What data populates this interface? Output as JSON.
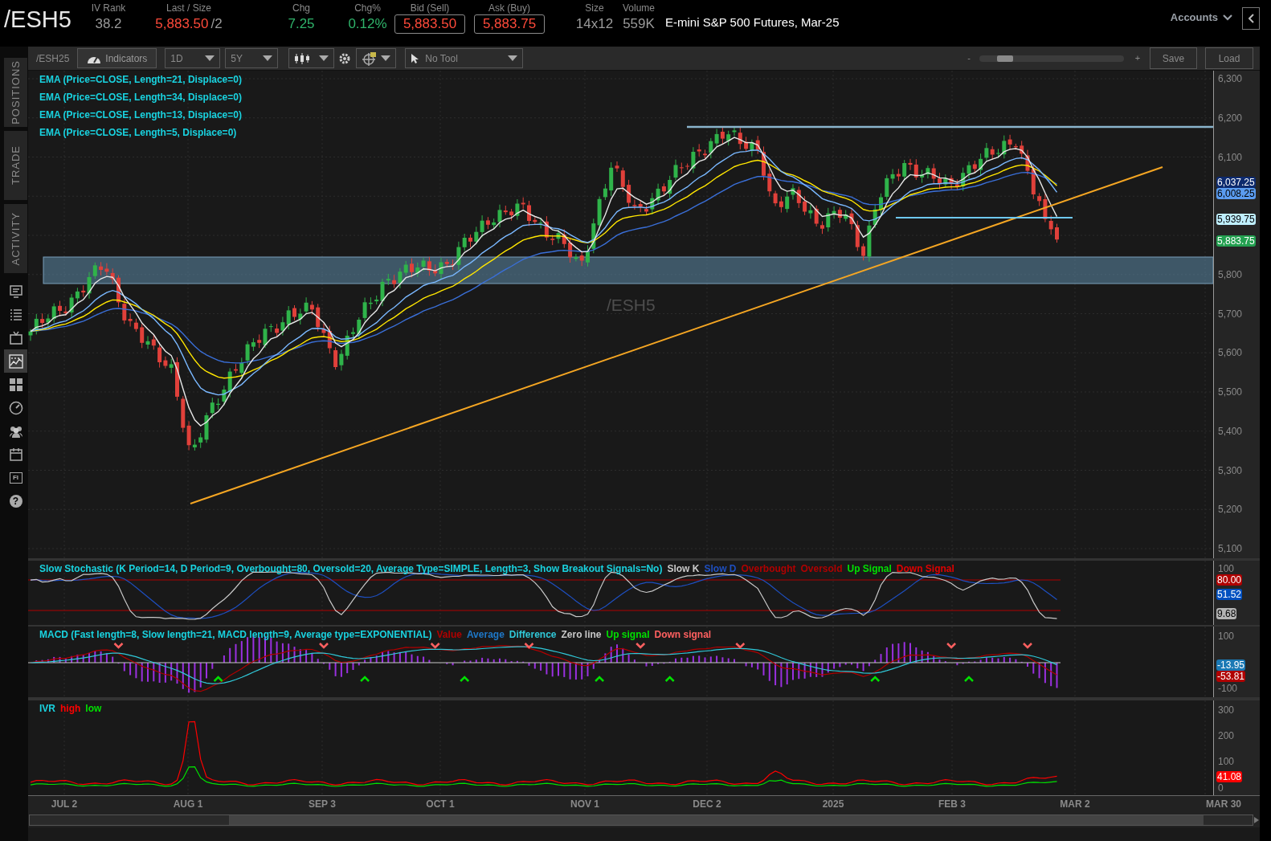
{
  "header": {
    "symbol": "/ESH5",
    "quote_fields": [
      {
        "label": "IV Rank",
        "value": "38.2",
        "color": "#9a9a9a",
        "boxed": false
      },
      {
        "label": "Last / Size",
        "value": "5,883.50",
        "size": "/2",
        "color": "#ff4a3a",
        "boxed": false
      },
      {
        "label": "Chg",
        "value": "7.25",
        "color": "#2fb36a",
        "boxed": false
      },
      {
        "label": "Chg%",
        "value": "0.12%",
        "color": "#2fb36a",
        "boxed": false
      },
      {
        "label": "Bid (Sell)",
        "value": "5,883.50",
        "color": "#ff4a3a",
        "boxed": true
      },
      {
        "label": "Ask (Buy)",
        "value": "5,883.75",
        "color": "#ff4a3a",
        "boxed": true
      },
      {
        "label": "Size",
        "value": "14x12",
        "color": "#9a9a9a",
        "boxed": false
      },
      {
        "label": "Volume",
        "value": "559K",
        "color": "#9a9a9a",
        "boxed": false
      }
    ],
    "description": "E-mini S&P 500 Futures, Mar-25",
    "accounts": "Accounts"
  },
  "side_tabs": [
    {
      "label": "POSITIONS",
      "selected": false
    },
    {
      "label": "TRADE",
      "selected": false
    },
    {
      "label": "ACTIVITY",
      "selected": false
    }
  ],
  "side_icons": [
    {
      "kind": "monitor",
      "selected": false
    },
    {
      "kind": "list",
      "selected": false
    },
    {
      "kind": "tv",
      "selected": false
    },
    {
      "kind": "chart",
      "selected": true
    },
    {
      "kind": "grid",
      "selected": false
    },
    {
      "kind": "gauge",
      "selected": false
    },
    {
      "kind": "people",
      "selected": false
    },
    {
      "kind": "calendar",
      "selected": false
    },
    {
      "kind": "fi",
      "glyph": "FI",
      "selected": false
    },
    {
      "kind": "help",
      "glyph": "?",
      "selected": false
    }
  ],
  "toolbar": {
    "symbol": "/ESH25",
    "indicators": "Indicators",
    "aggregation": "1D",
    "timeframe": "5Y",
    "tool": "No Tool",
    "zoom_minus": "-",
    "zoom_plus": "+",
    "zoom_slider": {
      "level": 0.14
    },
    "save": "Save",
    "load": "Load"
  },
  "price_panel": {
    "studies": [
      "EMA (Price=CLOSE, Length=21, Displace=0)",
      "EMA (Price=CLOSE, Length=34, Displace=0)",
      "EMA (Price=CLOSE, Length=13, Displace=0)",
      "EMA (Price=CLOSE, Length=5, Displace=0)"
    ],
    "symbol_label": "/ESH5",
    "y_axis": [
      "6,300",
      "6,200",
      "6,100",
      "5,800",
      "5,700",
      "5,600",
      "5,500",
      "5,400",
      "5,300",
      "5,200",
      "5,100"
    ],
    "badges": [
      {
        "text": "6,037.25",
        "color": "#0d2a6e"
      },
      {
        "text": "6,008.25",
        "color": "#5b9cf0"
      },
      {
        "text": "5,939.75",
        "color": "#bfefff"
      },
      {
        "text": "5,883.75",
        "color": "#23a050"
      }
    ]
  },
  "stochastic": {
    "title": "Slow Stochastic (K Period=14, D Period=9, Overbought=80, Oversold=20, Average Type=SIMPLE, Length=3, Show Breakout Signals=No)",
    "legend": [
      {
        "label": "Slow K",
        "color": "#c8c8c8"
      },
      {
        "label": "Slow D",
        "color": "#1e4fc0"
      },
      {
        "label": "Overbought",
        "color": "#b00000"
      },
      {
        "label": "Oversold",
        "color": "#b00000"
      },
      {
        "label": "Up Signal",
        "color": "#00e000"
      },
      {
        "label": "Down Signal",
        "color": "#e00000"
      }
    ],
    "y_axis": [
      "100"
    ],
    "badges": [
      {
        "text": "80.00",
        "color": "#b00000"
      },
      {
        "text": "51.52",
        "color": "#0050c0"
      },
      {
        "text": "9.68",
        "color": "#b4b4b4"
      }
    ]
  },
  "macd": {
    "title": "MACD (Fast length=8, Slow length=21, MACD length=9, Average type=EXPONENTIAL)",
    "legend": [
      {
        "label": "Value",
        "color": "#b00000"
      },
      {
        "label": "Average",
        "color": "#1e78c8"
      },
      {
        "label": "Difference",
        "color": "#30c8d8"
      },
      {
        "label": "Zero line",
        "color": "#c8c8c8"
      },
      {
        "label": "Up signal",
        "color": "#00e000"
      },
      {
        "label": "Down signal",
        "color": "#ff6060"
      }
    ],
    "y_axis": [
      "100",
      "-100"
    ],
    "badges": [
      {
        "text": "-13.95",
        "color": "#1a78b4"
      },
      {
        "text": "-53.81",
        "color": "#b00000"
      }
    ]
  },
  "ivr": {
    "title": "IVR",
    "legend": [
      {
        "label": "high",
        "color": "#ff0000"
      },
      {
        "label": "low",
        "color": "#00e000"
      }
    ],
    "y_axis": [
      "300",
      "200",
      "100",
      "0"
    ],
    "badges": [
      {
        "text": "41.08",
        "color": "#ff0000"
      }
    ]
  },
  "x_axis": [
    "JUL 2",
    "AUG 1",
    "SEP 3",
    "OCT 1",
    "NOV 1",
    "DEC 2",
    "2025",
    "FEB 3",
    "MAR 2",
    "MAR 30"
  ]
}
